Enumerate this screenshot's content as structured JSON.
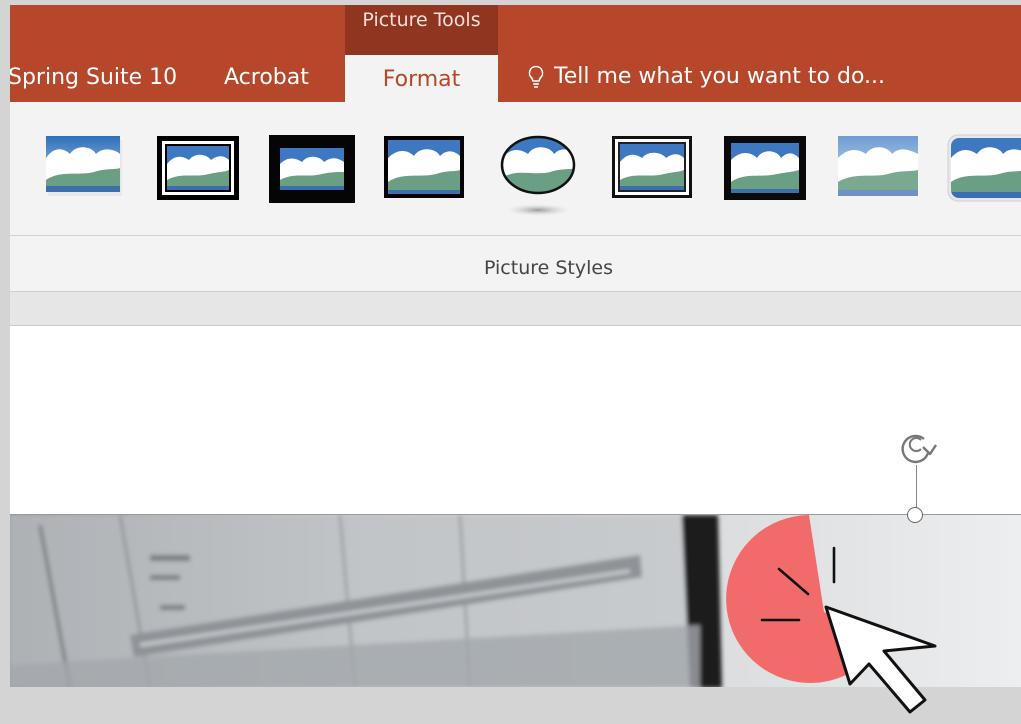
{
  "ribbon": {
    "context_group": "Picture Tools",
    "tabs": [
      {
        "label": "Spring Suite 10"
      },
      {
        "label": "Acrobat"
      },
      {
        "label": "Format",
        "active": true
      }
    ],
    "tell_me": {
      "icon": "lightbulb-icon",
      "text": "Tell me what you want to do..."
    }
  },
  "gallery": {
    "group_label": "Picture Styles",
    "styles": [
      {
        "name": "simple-frame-white"
      },
      {
        "name": "double-frame-black"
      },
      {
        "name": "thick-matte-black"
      },
      {
        "name": "simple-frame-black"
      },
      {
        "name": "oval-reflected"
      },
      {
        "name": "double-frame-white"
      },
      {
        "name": "metal-frame-black"
      },
      {
        "name": "soft-edge"
      },
      {
        "name": "rounded-rectangle"
      }
    ]
  },
  "slide": {
    "rotate_icon": "rotate-icon",
    "overlay_icon": "click-cursor-icon"
  },
  "colors": {
    "ribbon": "#b7472a",
    "context_group": "#8f3520",
    "cursor_highlight": "#f26b6b"
  }
}
